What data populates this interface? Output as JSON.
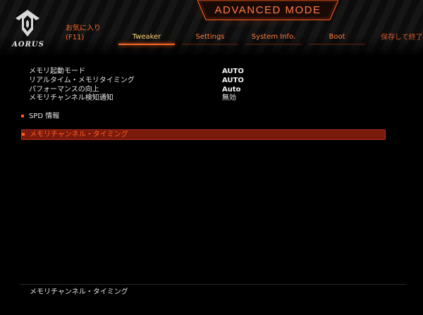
{
  "brand": {
    "name": "AORUS",
    "logo_icon": "eagle-icon"
  },
  "header": {
    "mode_title": "ADVANCED MODE",
    "favorites_line1": "お気に入り",
    "favorites_line2": "(F11)",
    "save_exit": "保存して終了"
  },
  "tabs": [
    {
      "label": "Tweaker",
      "active": true
    },
    {
      "label": "Settings",
      "active": false
    },
    {
      "label": "System Info.",
      "active": false
    },
    {
      "label": "Boot",
      "active": false
    }
  ],
  "settings": [
    {
      "label": "メモリ起動モード",
      "value": "AUTO"
    },
    {
      "label": "リアルタイム・メモリタイミング",
      "value": "AUTO"
    },
    {
      "label": "パフォーマンスの向上",
      "value": "Auto"
    },
    {
      "label": "メモリチャンネル検知通知",
      "value": "無効"
    }
  ],
  "submenus": [
    {
      "label": "SPD 情報",
      "selected": false
    },
    {
      "label": "メモリチャンネル・タイミング",
      "selected": true
    }
  ],
  "help": {
    "text": "メモリチャンネル・タイミング"
  },
  "colors": {
    "accent": "#ff6a25",
    "active_tab": "#ffd27a",
    "selection_bg": "#7a1a0c",
    "background": "#000000"
  }
}
